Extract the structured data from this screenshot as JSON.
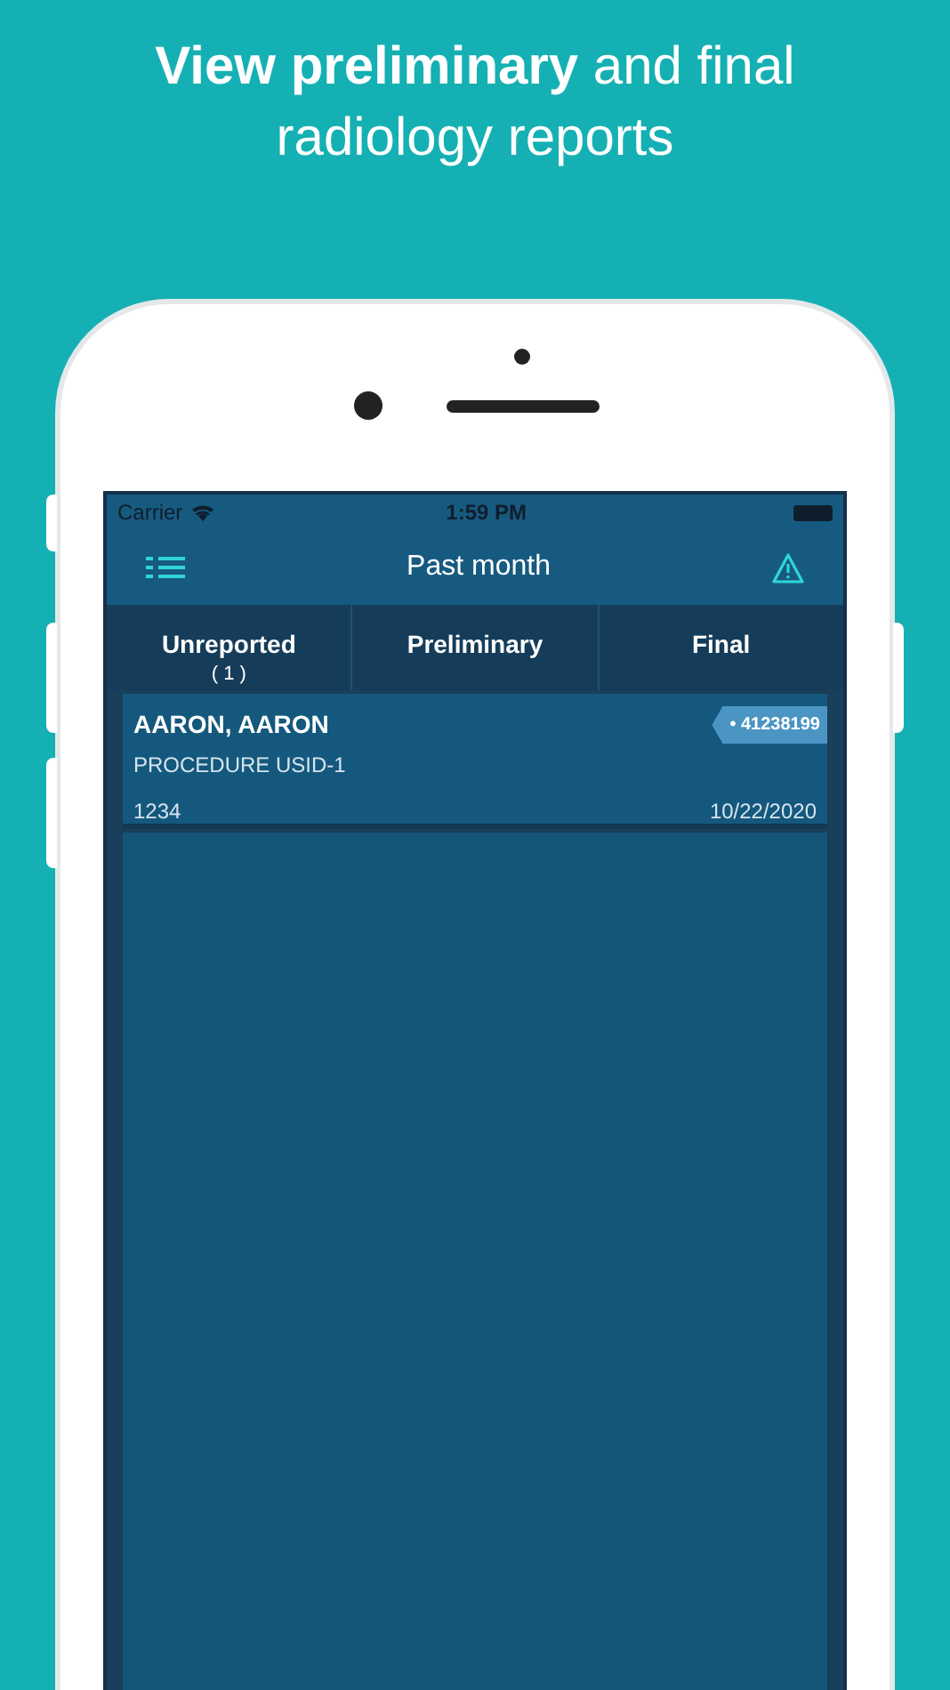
{
  "headline": "**View preliminary** and final radiology reports",
  "status_bar": {
    "carrier": "Carrier",
    "time": "1:59 PM"
  },
  "nav": {
    "title": "Past month"
  },
  "tabs": [
    {
      "label": "Unreported",
      "count": "( 1 )"
    },
    {
      "label": "Preliminary"
    },
    {
      "label": "Final"
    }
  ],
  "reports": [
    {
      "name": "AARON,  AARON",
      "tag": "• 41238199",
      "procedure": "PROCEDURE USID-1",
      "id": "1234",
      "date": "10/22/2020"
    }
  ]
}
